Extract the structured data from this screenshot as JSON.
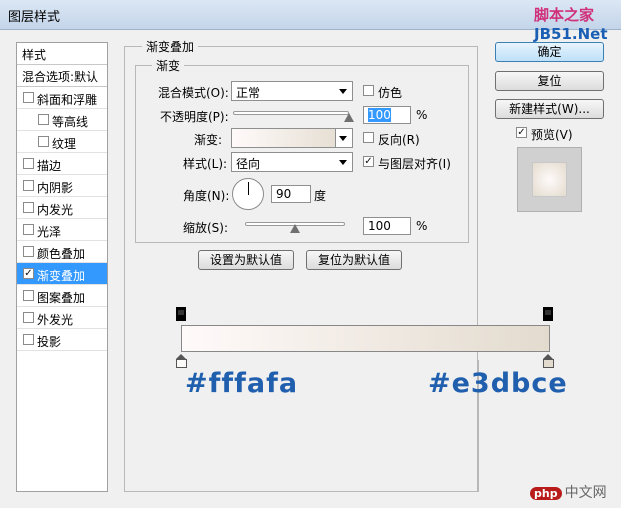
{
  "window": {
    "title": "图层样式"
  },
  "watermark": {
    "top1": "脚本之家",
    "top2": "JB51.Net",
    "bottom_badge": "php",
    "bottom_text": "中文网"
  },
  "styles_panel": {
    "header": "样式",
    "blend_default": "混合选项:默认",
    "items": [
      {
        "label": "斜面和浮雕",
        "checked": false
      },
      {
        "label": "等高线",
        "checked": false,
        "sub": true
      },
      {
        "label": "纹理",
        "checked": false,
        "sub": true
      },
      {
        "label": "描边",
        "checked": false
      },
      {
        "label": "内阴影",
        "checked": false
      },
      {
        "label": "内发光",
        "checked": false
      },
      {
        "label": "光泽",
        "checked": false
      },
      {
        "label": "颜色叠加",
        "checked": false
      },
      {
        "label": "渐变叠加",
        "checked": true,
        "selected": true
      },
      {
        "label": "图案叠加",
        "checked": false
      },
      {
        "label": "外发光",
        "checked": false
      },
      {
        "label": "投影",
        "checked": false
      }
    ]
  },
  "gradient_overlay": {
    "group_title": "渐变叠加",
    "sub_title": "渐变",
    "blend_mode_label": "混合模式(O):",
    "blend_mode_value": "正常",
    "dither_label": "仿色",
    "opacity_label": "不透明度(P):",
    "opacity_value": "100",
    "percent": "%",
    "gradient_label": "渐变:",
    "reverse_label": "反向(R)",
    "style_label": "样式(L):",
    "style_value": "径向",
    "align_label": "与图层对齐(I)",
    "angle_label": "角度(N):",
    "angle_value": "90",
    "angle_unit": "度",
    "scale_label": "缩放(S):",
    "scale_value": "100",
    "scale_percent": "%",
    "set_default": "设置为默认值",
    "reset_default": "复位为默认值",
    "opacity_level": 1.0,
    "scale_level": 0.5
  },
  "buttons": {
    "ok": "确定",
    "reset": "复位",
    "new_style": "新建样式(W)...",
    "preview_label": "预览(V)"
  },
  "gradient": {
    "start_color": "#fffafa",
    "end_color": "#e3dbce",
    "start_label": "#fffafa",
    "end_label": "#e3dbce"
  }
}
